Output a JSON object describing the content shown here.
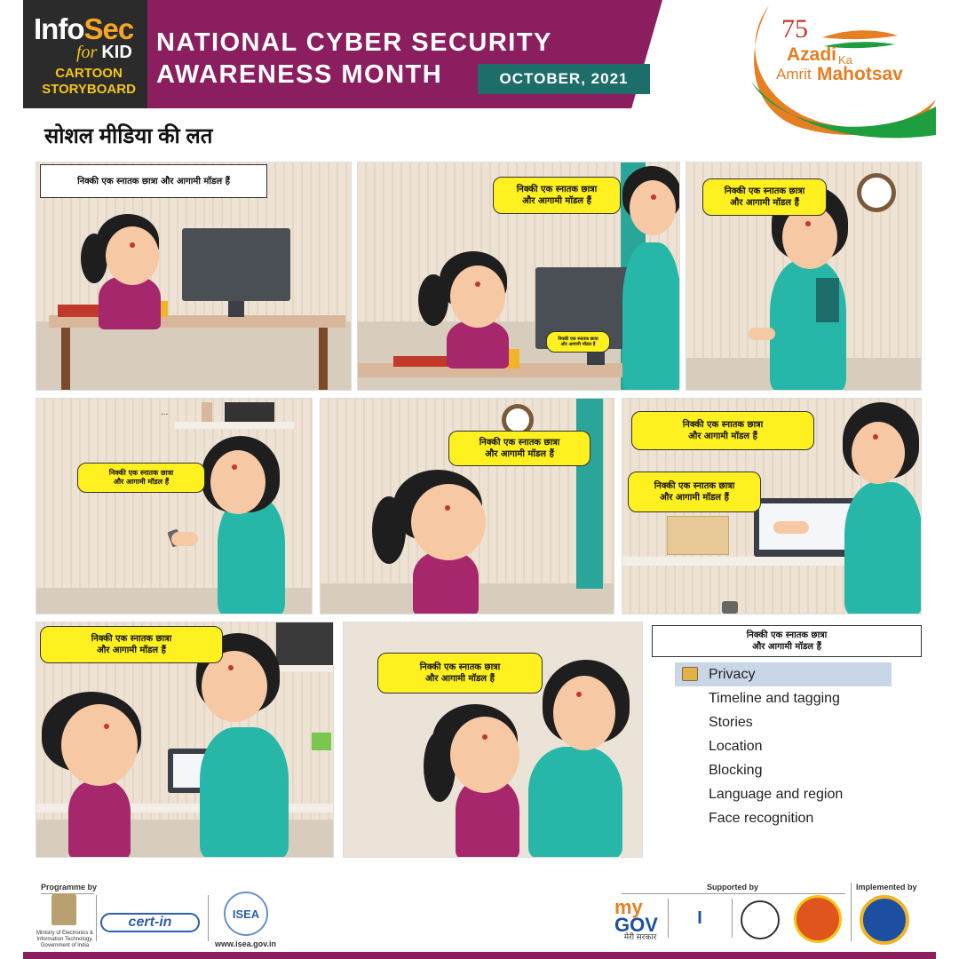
{
  "header": {
    "brand_info": "Info",
    "brand_sec": "Sec",
    "brand_for": "for",
    "brand_kid": "KID",
    "brand_line1": "CARTOON",
    "brand_line2": "STORYBOARD",
    "title_line1": "NATIONAL CYBER SECURITY",
    "title_line2": "AWARENESS MONTH",
    "date": "OCTOBER, 2021",
    "aka_number": "75",
    "aka_azadi": "Azadi",
    "aka_ka": "Ka",
    "aka_amrit": "Amrit",
    "aka_mahotsav": "Mahotsav"
  },
  "story": {
    "title": "सोशल मीडिया की लत"
  },
  "panels": {
    "p1_caption": "निक्की एक स्नातक छात्रा और आगामी मॉडल हैं",
    "p2_bubble_line1": "निक्की एक स्नातक छात्रा",
    "p2_bubble_line2": "और आगामी मॉडल हैं",
    "p2_screen_line1": "निक्की एक स्नातक छात्रा",
    "p2_screen_line2": "और आगामी मॉडल हैं",
    "p3_bubble_line1": "निक्की एक स्नातक छात्रा",
    "p3_bubble_line2": "और आगामी मॉडल हैं",
    "p4_dots": "...",
    "p4_bubble_line1": "निक्की एक स्नातक छात्रा",
    "p4_bubble_line2": "और आगामी मॉडल हैं",
    "p5_bubble_line1": "निक्की एक स्नातक छात्रा",
    "p5_bubble_line2": "और आगामी मॉडल हैं",
    "p6_bubble1_line1": "निक्की एक स्नातक छात्रा",
    "p6_bubble1_line2": "और आगामी मॉडल हैं",
    "p6_bubble2_line1": "निक्की एक स्नातक छात्रा",
    "p6_bubble2_line2": "और आगामी मॉडल हैं",
    "p7_bubble_line1": "निक्की एक स्नातक छात्रा",
    "p7_bubble_line2": "और आगामी मॉडल हैं",
    "p8_bubble_line1": "निक्की एक स्नातक छात्रा",
    "p8_bubble_line2": "और आगामी मॉडल हैं",
    "p9_caption_line1": "निक्की एक स्नातक छात्रा",
    "p9_caption_line2": "और आगामी मॉडल हैं"
  },
  "settings_menu": {
    "items": [
      "Privacy",
      "Timeline and tagging",
      "Stories",
      "Location",
      "Blocking",
      "Language and region",
      "Face recognition"
    ],
    "active_index": 0
  },
  "footer": {
    "programme_by": "Programme by",
    "ministry": "Ministry of Electronics & Information Technology, Government of India",
    "cert_name": "cert-in",
    "isea_name": "ISEA",
    "isea_url": "www.isea.gov.in",
    "supported_by": "Supported by",
    "mygov_my": "my",
    "mygov_gov": "GOV",
    "mygov_hindi": "मेरी सरकार",
    "implemented_by": "Implemented by"
  },
  "colors": {
    "header_band": "#8b1e5f",
    "date_badge": "#1d6e6a",
    "bubble": "#fff01f",
    "accent_orange": "#f5a623"
  }
}
